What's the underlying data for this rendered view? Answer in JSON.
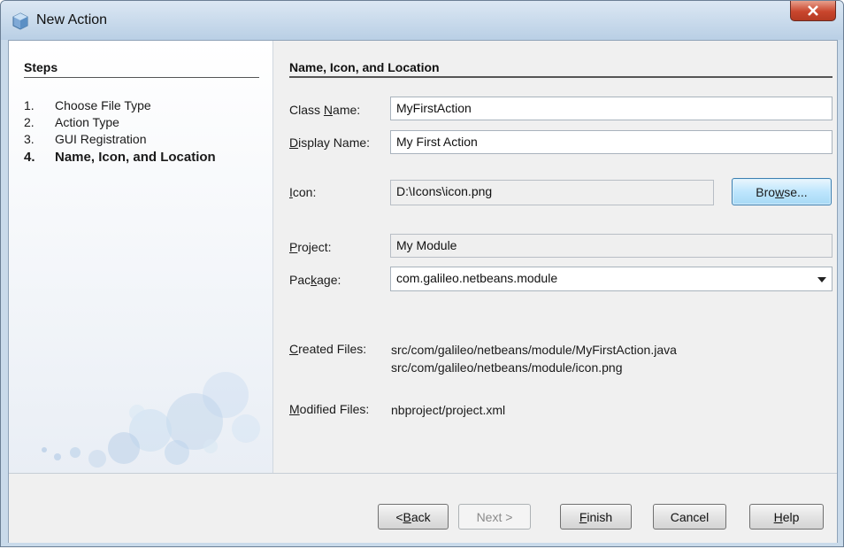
{
  "window": {
    "title": "New Action",
    "close_label": "×"
  },
  "steps": {
    "heading": "Steps",
    "items": [
      {
        "num": "1.",
        "label": "Choose File Type"
      },
      {
        "num": "2.",
        "label": "Action Type"
      },
      {
        "num": "3.",
        "label": "GUI Registration"
      },
      {
        "num": "4.",
        "label": "Name, Icon, and Location"
      }
    ],
    "active_index": 3
  },
  "form": {
    "section_title": "Name, Icon, and Location",
    "class_name": {
      "label_pre": "Class ",
      "label_mn": "N",
      "label_post": "ame:",
      "value": "MyFirstAction"
    },
    "display_name": {
      "label_pre": "",
      "label_mn": "D",
      "label_post": "isplay Name:",
      "value": "My First Action"
    },
    "icon": {
      "label_pre": "",
      "label_mn": "I",
      "label_post": "con:",
      "value": "D:\\Icons\\icon.png"
    },
    "browse": {
      "pre": "Bro",
      "mn": "w",
      "post": "se..."
    },
    "project": {
      "label_pre": "",
      "label_mn": "P",
      "label_post": "roject:",
      "value": "My Module"
    },
    "package": {
      "label_pre": "Pac",
      "label_mn": "k",
      "label_post": "age:",
      "value": "com.galileo.netbeans.module"
    },
    "created_files": {
      "label_pre": "",
      "label_mn": "C",
      "label_post": "reated Files:",
      "values": [
        "src/com/galileo/netbeans/module/MyFirstAction.java",
        "src/com/galileo/netbeans/module/icon.png"
      ]
    },
    "modified_files": {
      "label_pre": "",
      "label_mn": "M",
      "label_post": "odified Files:",
      "values": [
        "nbproject/project.xml"
      ]
    }
  },
  "footer": {
    "back": {
      "pre": "< ",
      "mn": "B",
      "post": "ack"
    },
    "next": {
      "label": "Next >"
    },
    "finish": {
      "pre": "",
      "mn": "F",
      "post": "inish"
    },
    "cancel": {
      "label": "Cancel"
    },
    "help": {
      "pre": "",
      "mn": "H",
      "post": "elp"
    }
  }
}
